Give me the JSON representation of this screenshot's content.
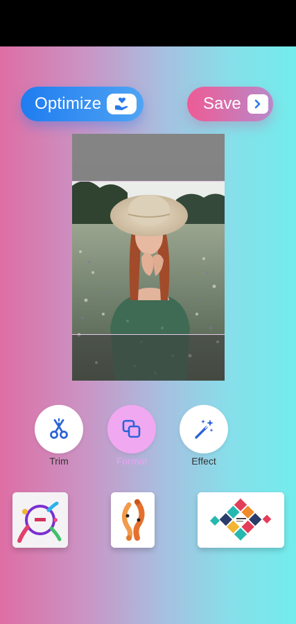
{
  "toolbar": {
    "optimize_label": "Optimize",
    "save_label": "Save"
  },
  "tools": [
    {
      "label": "Trim",
      "icon": "scissors-icon",
      "active": false
    },
    {
      "label": "Format",
      "icon": "copy-squares-icon",
      "active": true
    },
    {
      "label": "Effect",
      "icon": "magic-wand-icon",
      "active": false
    }
  ],
  "templates": [
    {
      "name": "template-colorful-circle"
    },
    {
      "name": "template-koi-fish"
    },
    {
      "name": "template-diamond-mosaic"
    }
  ],
  "colors": {
    "optimize_button": "#1f7cf0",
    "save_button": "#ee5b95",
    "format_active": "#f0a8f0",
    "tool_icon": "#2a62d8"
  }
}
